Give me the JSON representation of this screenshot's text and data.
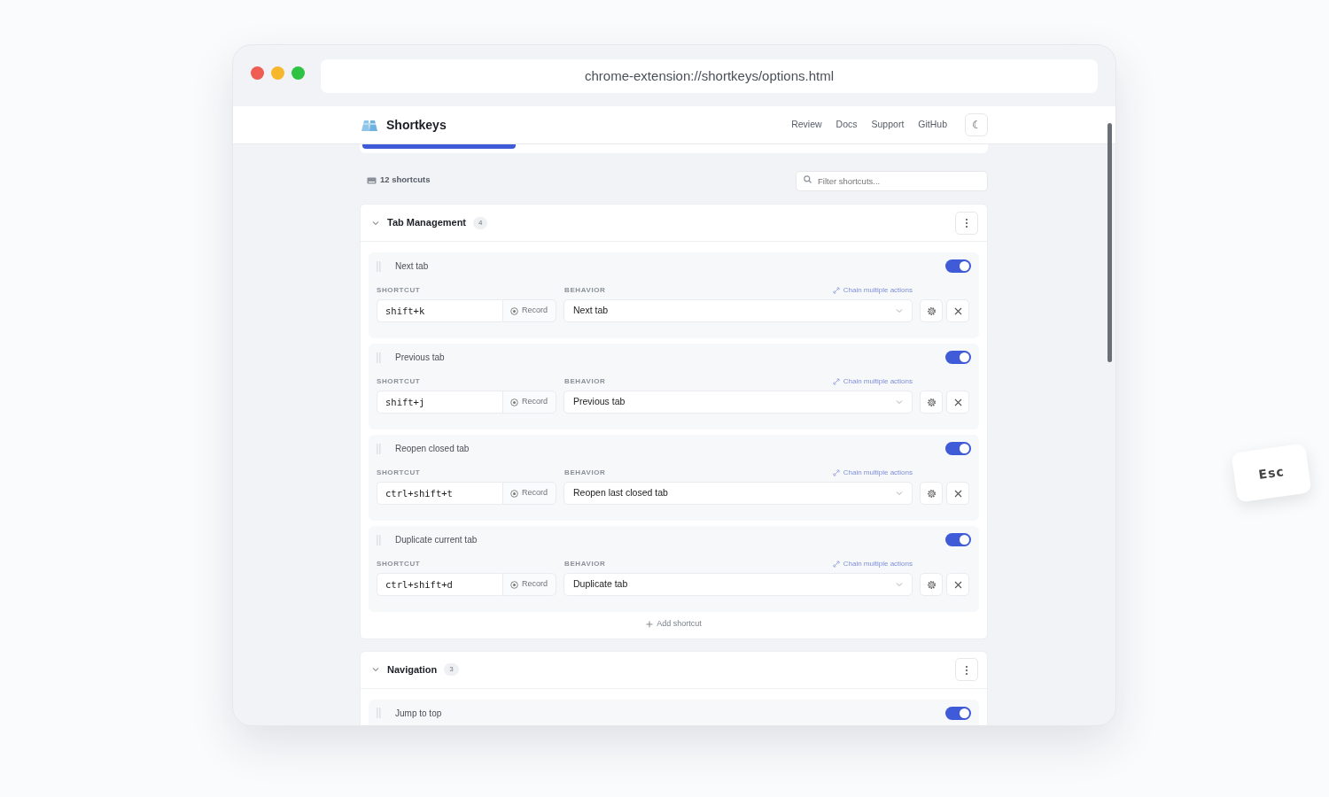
{
  "window": {
    "address": "chrome-extension://shortkeys/options.html"
  },
  "header": {
    "brand": "Shortkeys",
    "nav_links": [
      "Review",
      "Docs",
      "Support",
      "GitHub"
    ],
    "theme_toggle": "☾"
  },
  "toolbar": {
    "count": "12 shortcuts",
    "filter": {
      "placeholder": "Filter shortcuts..."
    }
  },
  "groups": [
    {
      "title": "Tab Management",
      "count": "4",
      "expanded": true,
      "shortcuts": [
        {
          "name": "Next tab",
          "enabled": true,
          "shortcut_label": "SHORTCUT",
          "shortcut": "shift+k",
          "record": "Record",
          "behavior_label": "BEHAVIOR",
          "chain_link": "Chain multiple actions",
          "behavior": "Next tab"
        },
        {
          "name": "Previous tab",
          "enabled": true,
          "shortcut_label": "SHORTCUT",
          "shortcut": "shift+j",
          "record": "Record",
          "behavior_label": "BEHAVIOR",
          "chain_link": "Chain multiple actions",
          "behavior": "Previous tab"
        },
        {
          "name": "Reopen closed tab",
          "enabled": true,
          "shortcut_label": "SHORTCUT",
          "shortcut": "ctrl+shift+t",
          "record": "Record",
          "behavior_label": "BEHAVIOR",
          "chain_link": "Chain multiple actions",
          "behavior": "Reopen last closed tab"
        },
        {
          "name": "Duplicate current tab",
          "enabled": true,
          "shortcut_label": "SHORTCUT",
          "shortcut": "ctrl+shift+d",
          "record": "Record",
          "behavior_label": "BEHAVIOR",
          "chain_link": "Chain multiple actions",
          "behavior": "Duplicate tab"
        }
      ],
      "add_button": "Add shortcut"
    },
    {
      "title": "Navigation",
      "count": "3",
      "expanded": true,
      "shortcuts": [
        {
          "name": "Jump to top",
          "enabled": true
        }
      ]
    }
  ],
  "floating_key": "Esc"
}
